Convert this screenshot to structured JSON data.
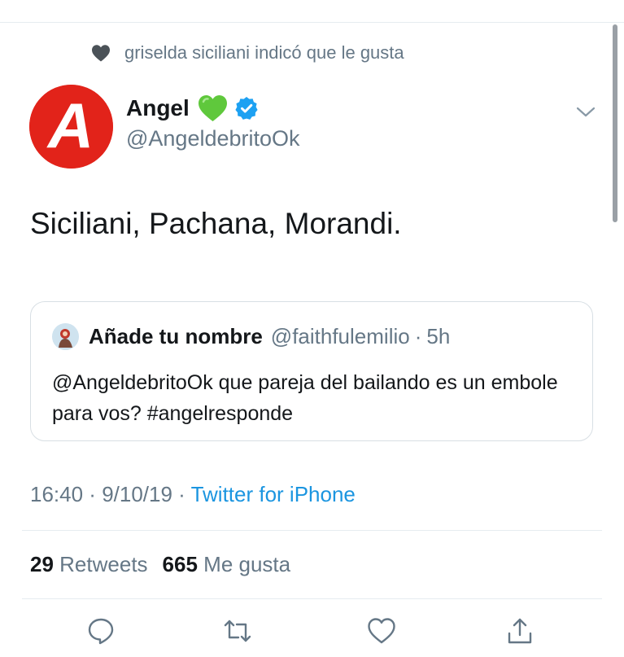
{
  "social_context": {
    "text": "griselda siciliani indicó que le gusta",
    "icon": "heart-icon"
  },
  "author": {
    "name": "Angel",
    "emoji": "💚",
    "handle": "@AngeldebritoOk",
    "avatar_letter": "A",
    "verified": true
  },
  "tweet": {
    "text": "Siciliani, Pachana, Morandi."
  },
  "quote": {
    "name": "Añade tu nombre",
    "handle": "@faithfulemilio",
    "separator": "·",
    "time": "5h",
    "text": "@AngeldebritoOk que pareja del bailando es un embole para vos? #angelresponde"
  },
  "meta": {
    "time": "16:40",
    "sep1": " · ",
    "date": "9/10/19",
    "sep2": " · ",
    "source": "Twitter for iPhone"
  },
  "stats": {
    "retweets_count": "29",
    "retweets_label": "Retweets",
    "likes_count": "665",
    "likes_label": "Me gusta"
  },
  "colors": {
    "accent": "#1da1f2",
    "link": "#1b95e0",
    "muted": "#657786",
    "avatar_red": "#e2231a"
  }
}
